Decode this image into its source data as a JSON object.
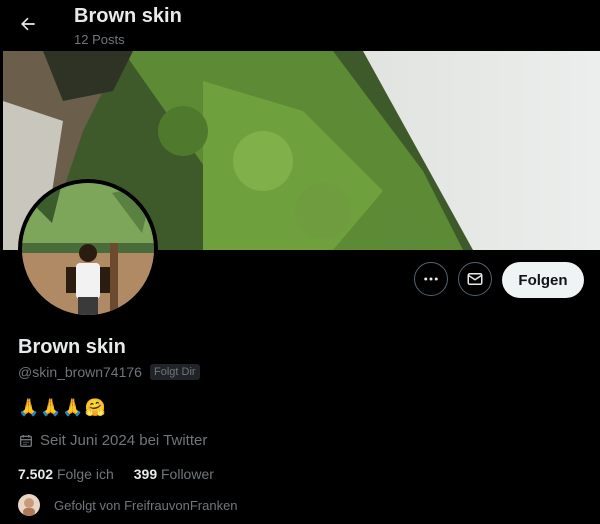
{
  "header": {
    "back_icon": "arrow-left-icon",
    "title": "Brown skin",
    "post_count": "12 Posts"
  },
  "profile": {
    "display_name": "Brown skin",
    "handle": "@skin_brown74176",
    "follows_you_badge": "Folgt Dir",
    "bio": "🙏🙏🙏🤗",
    "joined": "Seit Juni 2024 bei Twitter",
    "following_count": "7.502",
    "following_label": "Folge ich",
    "follower_count": "399",
    "follower_label": "Follower",
    "followed_by": "Gefolgt von FreifrauvonFranken"
  },
  "actions": {
    "more_icon": "more-dots-icon",
    "message_icon": "envelope-icon",
    "follow_label": "Folgen"
  },
  "colors": {
    "background": "#000000",
    "text_primary": "#e7e9ea",
    "text_secondary": "#71767b",
    "button_light": "#eff3f4"
  }
}
